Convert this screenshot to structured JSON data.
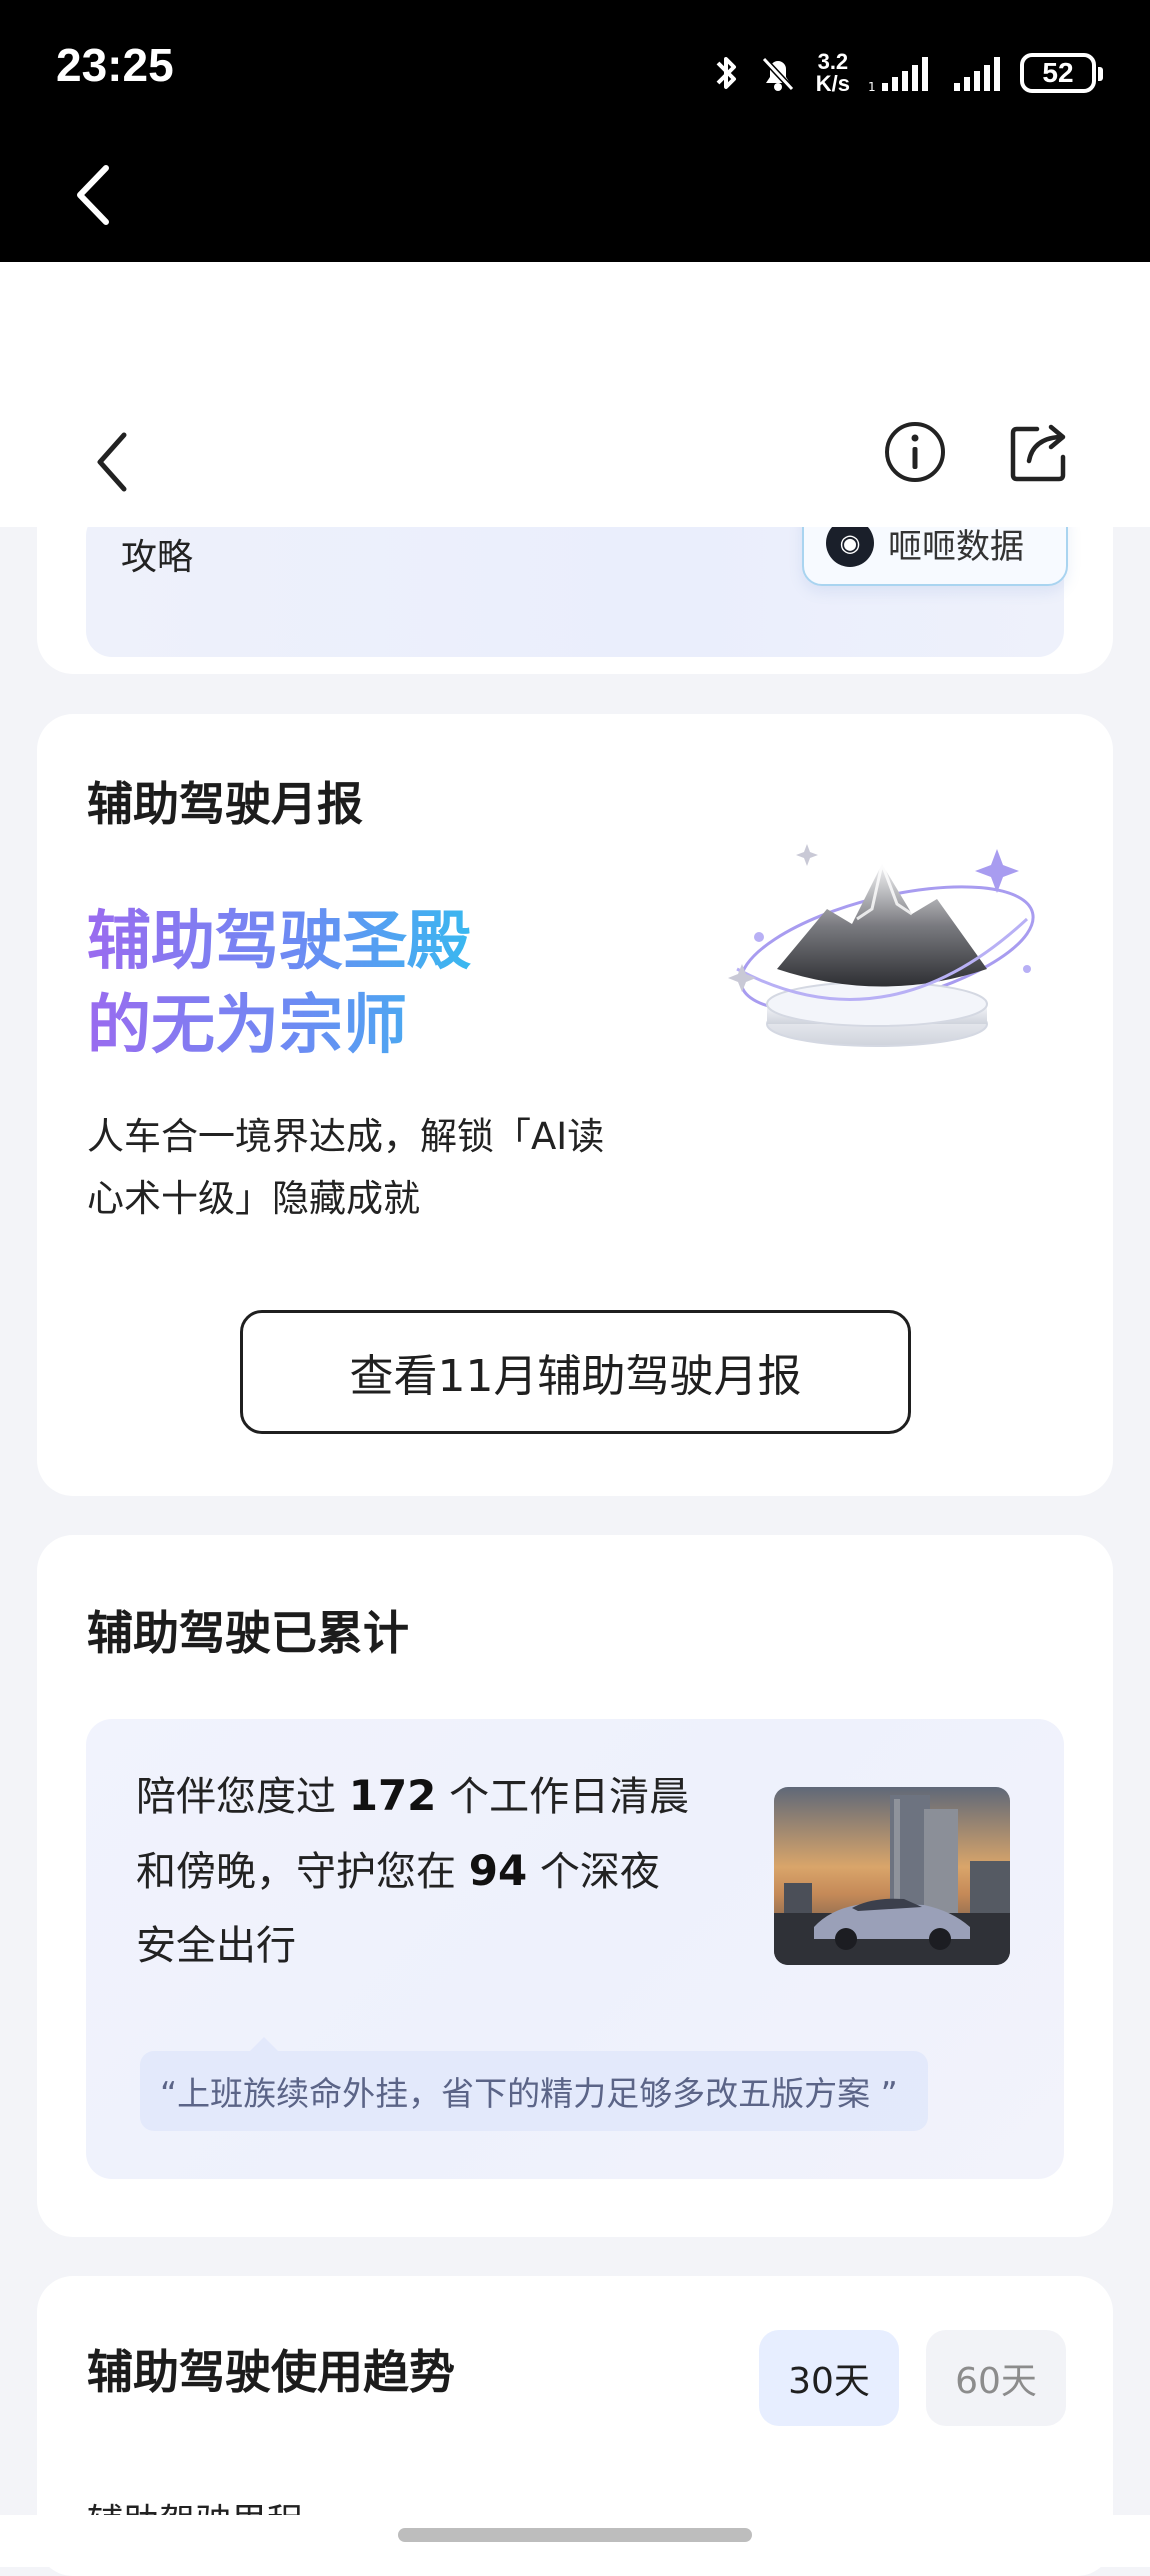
{
  "status_bar": {
    "time": "23:25",
    "net_speed_value": "3.2",
    "net_speed_unit": "K/s",
    "battery": "52"
  },
  "header": {
    "icons": [
      "back-icon",
      "info-icon",
      "share-icon"
    ]
  },
  "promo": {
    "text": "攻略",
    "badge_label": "咂咂数据"
  },
  "monthly_report": {
    "title": "辅助驾驶月报",
    "headline_line1": "辅助驾驶圣殿",
    "headline_line2": "的无为宗师",
    "desc_line1": "人车合一境界达成，解锁「AI读",
    "desc_line2": "心术十级」隐藏成就",
    "button_label": "查看11月辅助驾驶月报"
  },
  "cumulative": {
    "title": "辅助驾驶已累计",
    "l1_pre": "陪伴您度过 ",
    "workdays": "172",
    "l1_post": " 个工作日清晨",
    "l2_pre": "和傍晚，守护您在 ",
    "nights": "94",
    "l2_post": " 个深夜",
    "l3": "安全出行",
    "quote": "“上班族续命外挂，省下的精力足够多改五版方案 ”"
  },
  "trend": {
    "title": "辅助驾驶使用趋势",
    "tab_30": "30天",
    "tab_60": "60天",
    "subtitle": "辅助驾驶里程"
  }
}
